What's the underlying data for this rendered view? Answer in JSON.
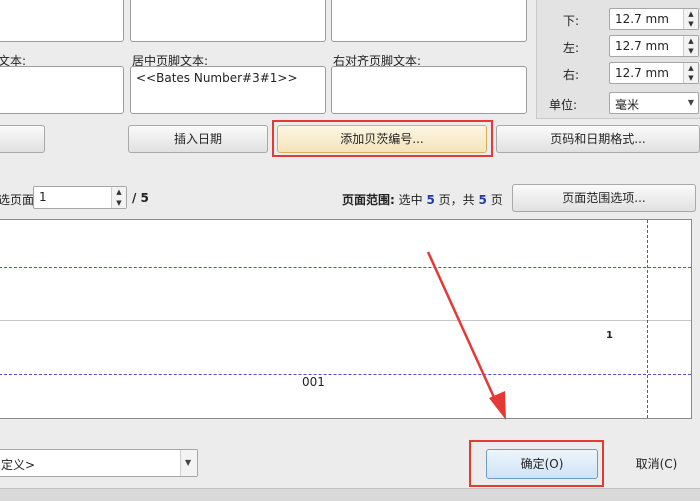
{
  "header_footer": {
    "left_label_fragment": "文本:",
    "center_label": "居中页脚文本:",
    "center_value": "<<Bates Number#3#1>>",
    "right_label": "右对齐页脚文本:"
  },
  "margins": {
    "bottom_label": "下:",
    "bottom_value": "12.7 mm",
    "left_label": "左:",
    "left_value": "12.7 mm",
    "right_label": "右:",
    "right_value": "12.7 mm",
    "unit_label": "单位:",
    "unit_value": "毫米"
  },
  "toolbar": {
    "insert_date": "插入日期",
    "add_bates": "添加贝茨编号...",
    "page_date_format": "页码和日期格式..."
  },
  "page_select": {
    "label_fragment": "选页面",
    "current_page": "1",
    "total": "/ 5",
    "range_label": "页面范围:",
    "range_text_1": "选中",
    "range_selected": "5",
    "range_text_2": "页，共",
    "range_total": "5",
    "range_text_3": "页",
    "range_options": "页面范围选项..."
  },
  "preview": {
    "page_number": "1",
    "bates_number": "001"
  },
  "bottom": {
    "preset_value": "定义>",
    "ok": "确定(O)",
    "cancel": "取消(C)"
  },
  "colors": {
    "highlight_box": "#e53935",
    "guide_lines": "#4a55c0",
    "arrow": "#e53935"
  }
}
